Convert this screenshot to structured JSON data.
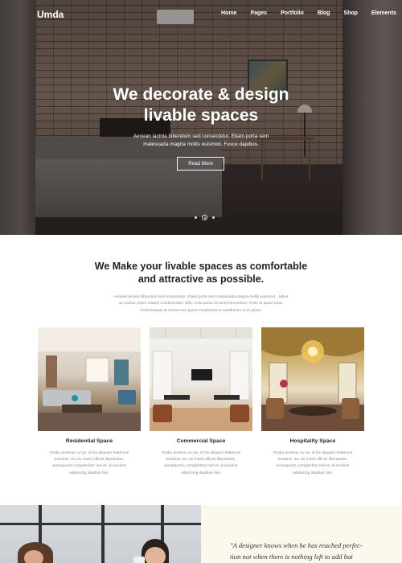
{
  "header": {
    "logo": "Umda",
    "menu": [
      "Home",
      "Pages",
      "Portfolio",
      "Blog",
      "Shop",
      "Elements"
    ]
  },
  "hero": {
    "title_line1": "We decorate & design",
    "title_line2": "livable spaces",
    "subtitle_line1": "Aenean lacinia bibendum sed consectetur. Etiam porta sem",
    "subtitle_line2": "malesuada magna mollis euismod. Fusce dapibus.",
    "button_label": "Read More",
    "slider_dots": 3,
    "active_dot": 1
  },
  "intro": {
    "title_line1": "We Make your livable spaces as comfortable",
    "title_line2": "and attractive as possible.",
    "text_line1": "Aenean lacinia bibendum sed consectetur. Etiam porta sem malesuada magna mollis euismod. . tellus",
    "text_line2": "ac cursus, tortor mauris condimentum nibh, Cras purus sit amet fermentum. Proin at quam urna.",
    "text_line3": "Pellentesque at massa nec purus condimentum vestibulum et et purus."
  },
  "cards": [
    {
      "title": "Residential Space",
      "text_line1": "Orabo pertinax cu vix, id his aliquam habemus",
      "text_line2": "tractatos. Eu vis modo officiis liberavisse,",
      "text_line3": "persequeris complectitur mel et, id invidunt",
      "text_line4": "adipiscing dapibus has."
    },
    {
      "title": "Commercial Space",
      "text_line1": "Orabo pertinax cu vix, id his aliquam habemus",
      "text_line2": "tractatos. Eu vis modo officiis liberavisse,",
      "text_line3": "persequeris complectitur mel et, id invidunt",
      "text_line4": "adipiscing dapibus has."
    },
    {
      "title": "Hospitality Space",
      "text_line1": "Orabo pertinax cu vix, id his aliquam habemus",
      "text_line2": "tractatos. Eu vis modo officiis liberavisse,",
      "text_line3": "persequeris complectitur mel et, id invidunt",
      "text_line4": "adipiscing dapibus has."
    }
  ],
  "quote": {
    "line1": "\"A designer knows when he has reached perfec-",
    "line2": "tion not when there is nothing left to add but"
  },
  "colors": {
    "accent_text": "#222222",
    "muted_text": "#888888",
    "quote_background": "#fbf8ee"
  }
}
